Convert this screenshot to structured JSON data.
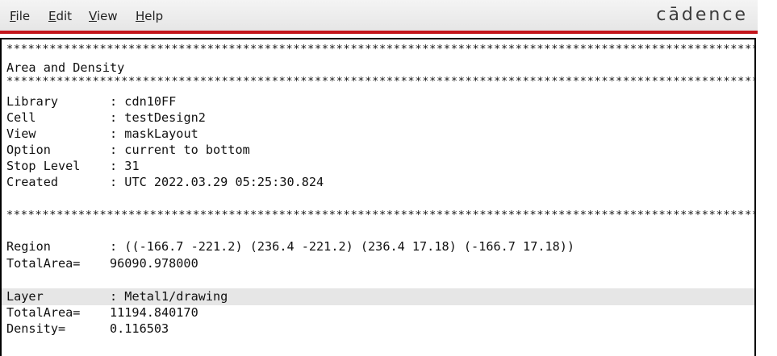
{
  "menubar": {
    "file": "File",
    "edit": "Edit",
    "view": "View",
    "help": "Help",
    "file_mn": "F",
    "file_rest": "ile",
    "edit_mn": "E",
    "edit_rest": "dit",
    "view_mn": "V",
    "view_rest": "iew",
    "help_mn": "H",
    "help_rest": "elp"
  },
  "brand": {
    "logo_text": "cādence",
    "accent_color": "#c4161c"
  },
  "report": {
    "separator": "**************************************************************************************************************",
    "title": "Area and Density",
    "header": [
      {
        "key": "Library",
        "value": "cdn10FF"
      },
      {
        "key": "Cell",
        "value": "testDesign2"
      },
      {
        "key": "View",
        "value": "maskLayout"
      },
      {
        "key": "Option",
        "value": "current to bottom"
      },
      {
        "key": "Stop Level",
        "value": "31"
      },
      {
        "key": "Created",
        "value": "UTC 2022.03.29 05:25:30.824"
      }
    ],
    "region": {
      "label": "Region",
      "value": "((-166.7 -221.2) (236.4 -221.2) (236.4 17.18) (-166.7 17.18))",
      "total_area_label": "TotalArea=",
      "total_area": "96090.978000"
    },
    "layer": {
      "label": "Layer",
      "value": "Metal1/drawing",
      "total_area_label": "TotalArea=",
      "total_area": "11194.840170",
      "density_label": "Density=",
      "density": "0.116503"
    }
  }
}
